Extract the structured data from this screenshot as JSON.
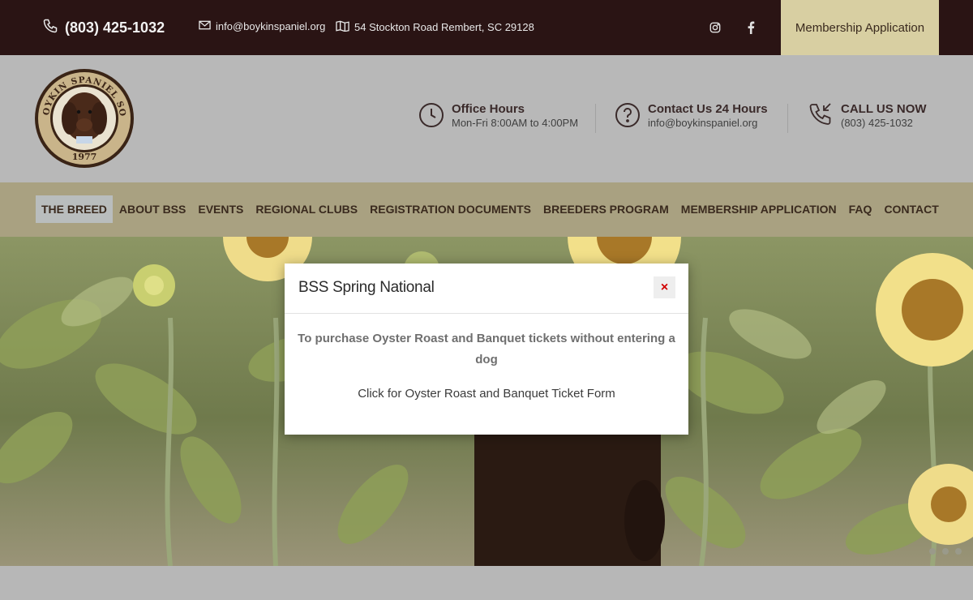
{
  "topbar": {
    "phone": "(803) 425-1032",
    "email": "info@boykinspaniel.org",
    "address": "54 Stockton Road Rembert, SC 29128",
    "social": [
      "instagram-icon",
      "facebook-icon"
    ],
    "membership_button": "Membership Application"
  },
  "logo": {
    "top_text": "THE BOYKIN SPANIEL SOCIETY",
    "year": "1977"
  },
  "header": {
    "info": [
      {
        "icon": "clock-icon",
        "title": "Office Hours",
        "sub": "Mon-Fri 8:00AM to 4:00PM"
      },
      {
        "icon": "question-icon",
        "title": "Contact Us 24 Hours",
        "sub": "info@boykinspaniel.org"
      },
      {
        "icon": "phone-call-icon",
        "title": "CALL US NOW",
        "sub": "(803) 425-1032"
      }
    ]
  },
  "nav": {
    "items": [
      "THE BREED",
      "ABOUT BSS",
      "EVENTS",
      "REGIONAL CLUBS",
      "REGISTRATION DOCUMENTS",
      "BREEDERS PROGRAM",
      "MEMBERSHIP APPLICATION",
      "FAQ",
      "CONTACT"
    ],
    "active": "THE BREED"
  },
  "modal": {
    "title": "BSS Spring National",
    "close_label": "×",
    "message": "To purchase Oyster Roast and Banquet tickets without entering a dog",
    "link_text": "Click for Oyster Roast and Banquet Ticket Form"
  },
  "colors": {
    "topbar_bg": "#2a1414",
    "accent": "#d8cfa2",
    "nav_bg": "#a9a181",
    "close_red": "#d10000"
  }
}
